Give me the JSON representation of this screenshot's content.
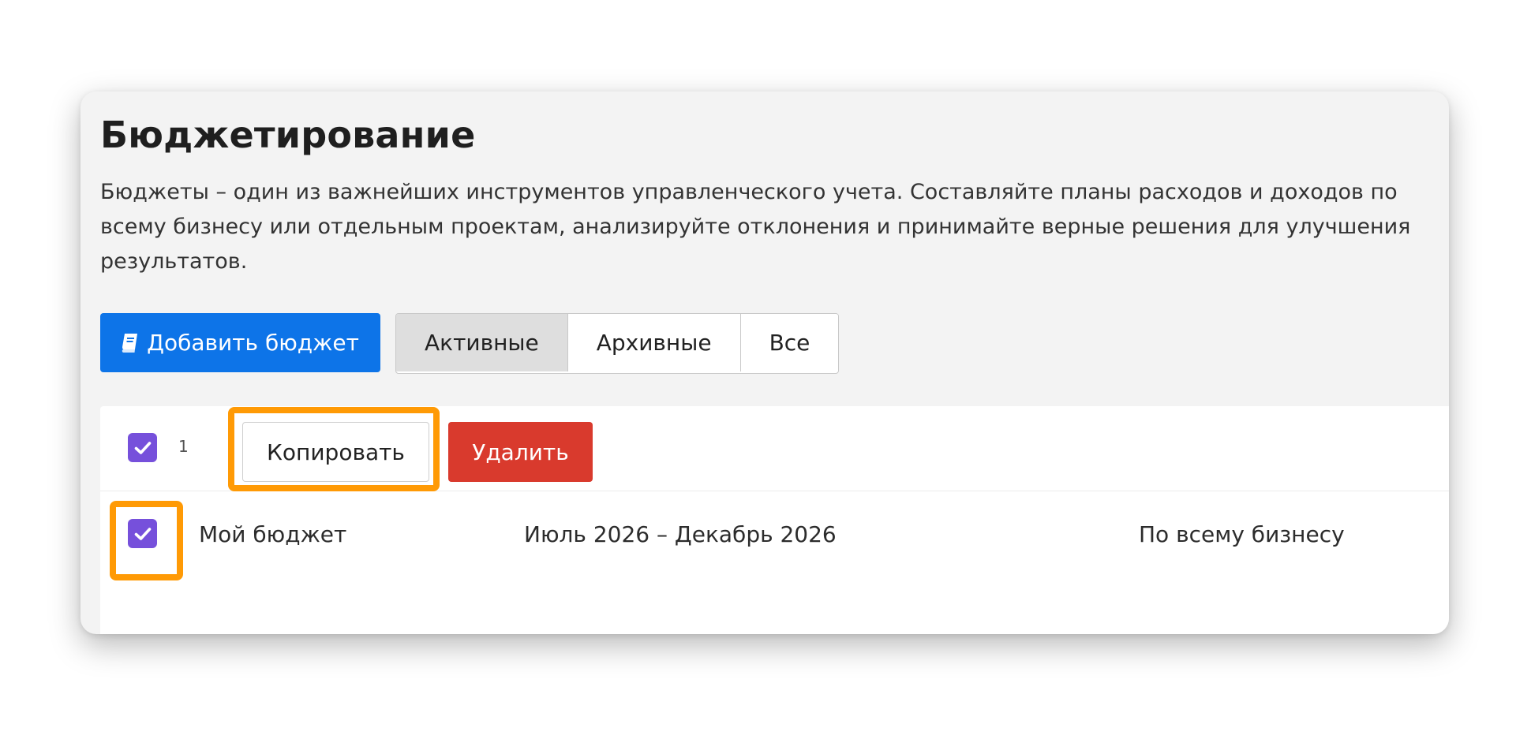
{
  "page": {
    "title": "Бюджетирование",
    "description": "Бюджеты – один из важнейших инструментов управленческого учета. Составляйте планы расходов и доходов по всему бизнесу или отдельным проектам, анализируйте отклонения и принимайте верные решения для улучшения результатов."
  },
  "actions": {
    "add_budget_label": "Добавить бюджет",
    "add_budget_icon": "book-icon"
  },
  "filters": {
    "active_label": "Активные",
    "archived_label": "Архивные",
    "all_label": "Все",
    "selected": "Активные"
  },
  "toolbar": {
    "selected_count": "1",
    "copy_label": "Копировать",
    "delete_label": "Удалить"
  },
  "budgets": [
    {
      "name": "Мой бюджет",
      "period": "Июль 2026 – Декабрь 2026",
      "scope": "По всему бизнесу",
      "checked": true
    }
  ],
  "colors": {
    "primary": "#0d74e8",
    "danger": "#d93a2d",
    "checkbox": "#7650db",
    "highlight": "#ff9a05"
  }
}
